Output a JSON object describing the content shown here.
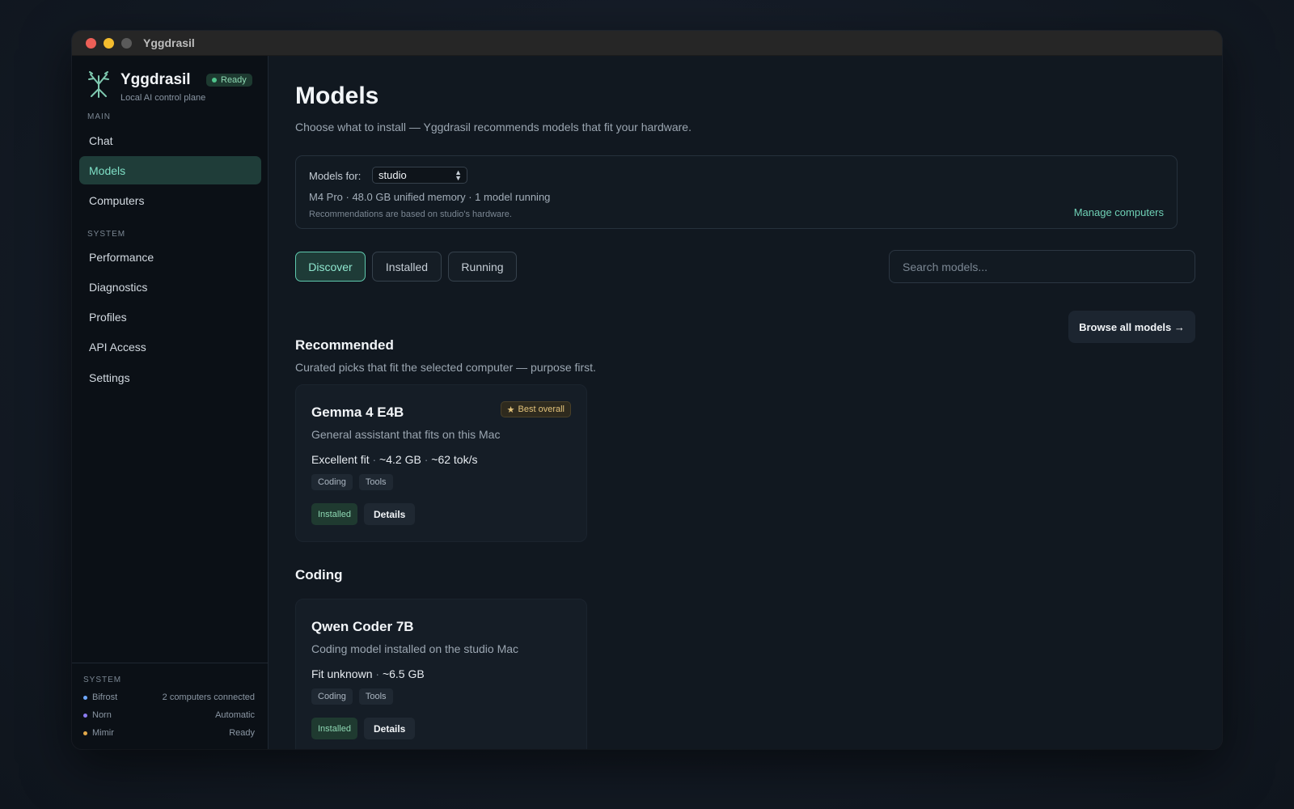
{
  "window": {
    "title": "Yggdrasil"
  },
  "brand": {
    "name": "Yggdrasil",
    "status": "Ready",
    "subtitle": "Local AI control plane"
  },
  "sidebar": {
    "main_label": "MAIN",
    "main_items": [
      {
        "label": "Chat"
      },
      {
        "label": "Models",
        "active": true
      },
      {
        "label": "Computers"
      }
    ],
    "system_label": "SYSTEM",
    "system_items": [
      {
        "label": "Performance"
      },
      {
        "label": "Diagnostics"
      },
      {
        "label": "Profiles"
      },
      {
        "label": "API Access"
      },
      {
        "label": "Settings"
      }
    ],
    "footer": {
      "title": "SYSTEM",
      "rows": [
        {
          "name": "Bifrost",
          "value": "2 computers connected",
          "color": "#6ea8ff"
        },
        {
          "name": "Norn",
          "value": "Automatic",
          "color": "#8b7cf0"
        },
        {
          "name": "Mimir",
          "value": "Ready",
          "color": "#e2a84a"
        }
      ]
    }
  },
  "page": {
    "title": "Models",
    "subtitle": "Choose what to install — Yggdrasil recommends models that fit your hardware."
  },
  "hardware": {
    "label": "Models for:",
    "selected": "studio",
    "specs": "M4 Pro · 48.0 GB unified memory · 1 model running",
    "note": "Recommendations are based on studio's hardware.",
    "manage": "Manage computers"
  },
  "tabs": [
    {
      "label": "Discover",
      "active": true
    },
    {
      "label": "Installed"
    },
    {
      "label": "Running"
    }
  ],
  "search": {
    "placeholder": "Search models..."
  },
  "recommended": {
    "title": "Recommended",
    "subtitle": "Curated picks that fit the selected computer — purpose first.",
    "browse": "Browse all models →",
    "card": {
      "name": "Gemma 4 E4B",
      "badge": "Best overall",
      "desc": "General assistant that fits on this Mac",
      "fit": "Excellent fit",
      "size": "~4.2 GB",
      "speed": "~62 tok/s",
      "tags": [
        "Coding",
        "Tools"
      ],
      "status": "Installed",
      "details": "Details"
    }
  },
  "coding": {
    "title": "Coding",
    "card": {
      "name": "Qwen Coder 7B",
      "desc": "Coding model installed on the studio Mac",
      "fit": "Fit unknown",
      "size": "~6.5 GB",
      "tags": [
        "Coding",
        "Tools"
      ],
      "status": "Installed",
      "details": "Details"
    }
  },
  "colors": {
    "accent": "#6fd0b5",
    "active_bg": "#1f3d39",
    "badge_gold": "#e2c27a"
  }
}
